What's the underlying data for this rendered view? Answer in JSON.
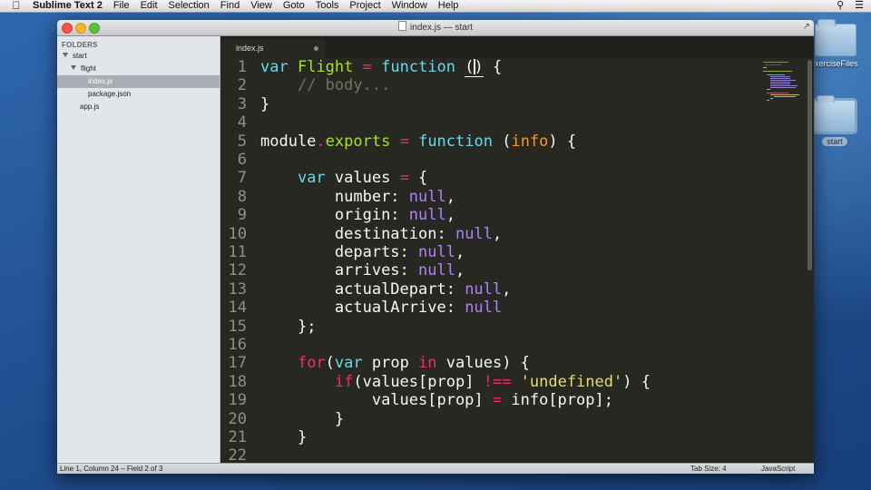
{
  "menubar": {
    "app": "Sublime Text 2",
    "items": [
      "File",
      "Edit",
      "Selection",
      "Find",
      "View",
      "Goto",
      "Tools",
      "Project",
      "Window",
      "Help"
    ]
  },
  "desktop": {
    "icons": [
      {
        "label": "xerciseFiles"
      },
      {
        "label": "start"
      }
    ]
  },
  "window": {
    "title": "index.js — start"
  },
  "sidebar": {
    "header": "FOLDERS",
    "items": [
      {
        "label": "start"
      },
      {
        "label": "flight"
      },
      {
        "label": "index.js"
      },
      {
        "label": "package.json"
      },
      {
        "label": "app.js"
      }
    ]
  },
  "tab": {
    "label": "index.js"
  },
  "editor": {
    "line_numbers": [
      "1",
      "2",
      "3",
      "4",
      "5",
      "6",
      "7",
      "8",
      "9",
      "10",
      "11",
      "12",
      "13",
      "14",
      "15",
      "16",
      "17",
      "18",
      "19",
      "20",
      "21",
      "22"
    ],
    "code": {
      "l1": {
        "var": "var",
        "name": "Flight",
        "eq": "=",
        "fn": "function",
        "open": "(",
        "close": ")",
        "brace": " {"
      },
      "l2": {
        "comment": "// body..."
      },
      "l3": {
        "text": "}"
      },
      "l5": {
        "obj": "module",
        "dot": ".",
        "prop": "exports",
        "eq": "=",
        "fn": "function",
        "open": " (",
        "param": "info",
        "close": ") {"
      },
      "l7": {
        "var": "var",
        "name": " values ",
        "eq": "=",
        "brace": " {"
      },
      "fields": [
        {
          "key": "number: ",
          "val": "null",
          "end": ","
        },
        {
          "key": "origin: ",
          "val": "null",
          "end": ","
        },
        {
          "key": "destination: ",
          "val": "null",
          "end": ","
        },
        {
          "key": "departs: ",
          "val": "null",
          "end": ","
        },
        {
          "key": "arrives: ",
          "val": "null",
          "end": ","
        },
        {
          "key": "actualDepart: ",
          "val": "null",
          "end": ","
        },
        {
          "key": "actualArrive: ",
          "val": "null",
          "end": ""
        }
      ],
      "l15": {
        "text": "};"
      },
      "l17": {
        "for": "for",
        "open": "(",
        "var": "var",
        "mid": " prop ",
        "in": "in",
        "rest": " values) {"
      },
      "l18": {
        "if": "if",
        "mid": "(values[prop] ",
        "op": "!==",
        "sp": " ",
        "str": "'undefined'",
        "rest": ") {"
      },
      "l19": {
        "a": "values[prop] ",
        "eq": "=",
        "b": " info[prop];"
      },
      "l20": {
        "text": "}"
      },
      "l21": {
        "text": "}"
      }
    }
  },
  "statusbar": {
    "position": "Line 1, Column 24 – Field 2 of 3",
    "tab_size": "Tab Size: 4",
    "syntax": "JavaScript"
  },
  "colors": {
    "editor_bg": "#272822",
    "keyword": "#66d9ef",
    "operator": "#f92672",
    "function_name": "#a6e22e",
    "parameter": "#fd971f",
    "comment": "#75715e",
    "constant": "#ae81ff",
    "string": "#e6db74"
  }
}
